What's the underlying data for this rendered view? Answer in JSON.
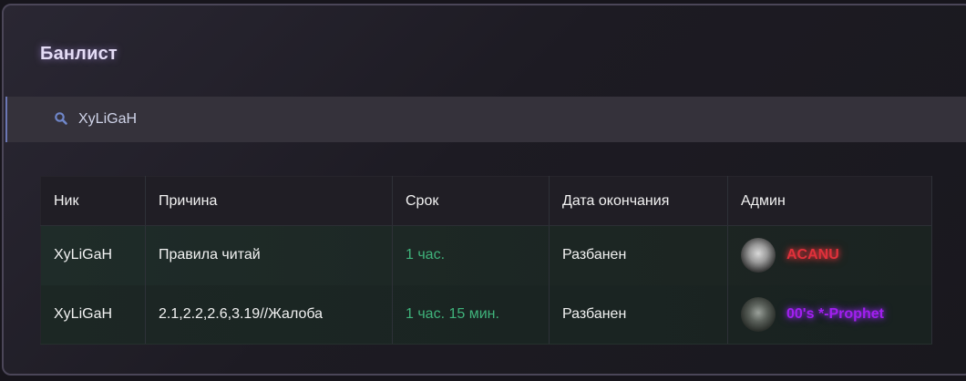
{
  "header": {
    "title": "Банлист"
  },
  "search": {
    "value": "XyLiGaH",
    "placeholder": ""
  },
  "table": {
    "columns": [
      "Ник",
      "Причина",
      "Срок",
      "Дата окончания",
      "Админ"
    ],
    "rows": [
      {
        "nick": "XyLiGaH",
        "reason": "Правила читай",
        "term": "1 час.",
        "end_date": "Разбанен",
        "admin": "ACANU"
      },
      {
        "nick": "XyLiGaH",
        "reason": "2.1,2.2,2.6,3.19//Жалоба",
        "term": "1 час. 15 мин.",
        "end_date": "Разбанен",
        "admin": "00's *-Prophet"
      }
    ]
  },
  "colors": {
    "term_text": "#3fb37b",
    "admin_1": "#e0313b",
    "admin_2": "#a21ff0",
    "title_glow": "#e4dcf5"
  },
  "icons": {
    "search": "search-icon"
  }
}
